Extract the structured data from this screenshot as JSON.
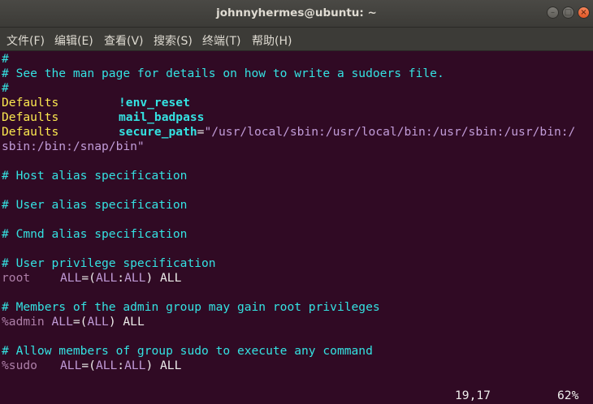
{
  "window": {
    "title": "johnnyhermes@ubuntu: ~",
    "controls": [
      "minimize",
      "maximize",
      "close"
    ]
  },
  "menu": {
    "items": [
      "文件(F)",
      "编辑(E)",
      "查看(V)",
      "搜索(S)",
      "终端(T)",
      "帮助(H)"
    ]
  },
  "editor": {
    "lines": {
      "l1": "#",
      "l2": "# See the man page for details on how to write a sudoers file.",
      "l3": "#",
      "l4_kw": "Defaults",
      "l4_val": "!env_reset",
      "l5_kw": "Defaults",
      "l5_val": "mail_badpass",
      "l6_kw": "Defaults",
      "l6_val": "secure_path",
      "l6_eq": "=",
      "l6_str": "\"/usr/local/sbin:/usr/local/bin:/usr/sbin:/usr/bin:/",
      "l7_str": "sbin:/bin:/snap/bin\"",
      "l8": "# Host alias specification",
      "l9": "# User alias specification",
      "l10": "# Cmnd alias specification",
      "l11": "# User privilege specification",
      "l12_user": "root",
      "l12_a": "ALL",
      "l12_b": "=(",
      "l12_c": "ALL",
      "l12_d": ":",
      "l12_e": "ALL",
      "l12_f": ") ALL",
      "l13": "# Members of the admin group may gain root privileges",
      "l14_user": "%admin",
      "l14_a": "ALL",
      "l14_b": "=(",
      "l14_c": "ALL",
      "l14_d": ") ALL",
      "l15": "# Allow members of group sudo to execute any command",
      "l16_user": "%sudo",
      "l16_a": "ALL",
      "l16_b": "=(",
      "l16_c": "ALL",
      "l16_d": ":",
      "l16_e": "ALL",
      "l16_f": ") ALL"
    },
    "status": {
      "position": "19,17",
      "percent": "62%"
    }
  },
  "colors": {
    "background": "#300a24",
    "comment": "#34e2e2",
    "keyword": "#fce94f",
    "string": "#c19cd8",
    "user": "#ad7fa8"
  }
}
